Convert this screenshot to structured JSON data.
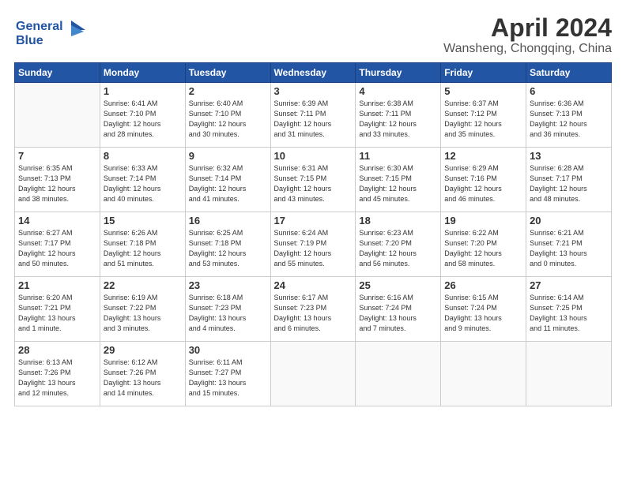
{
  "logo": {
    "line1": "General",
    "line2": "Blue"
  },
  "title": "April 2024",
  "location": "Wansheng, Chongqing, China",
  "headers": [
    "Sunday",
    "Monday",
    "Tuesday",
    "Wednesday",
    "Thursday",
    "Friday",
    "Saturday"
  ],
  "weeks": [
    [
      {
        "day": "",
        "info": ""
      },
      {
        "day": "1",
        "info": "Sunrise: 6:41 AM\nSunset: 7:10 PM\nDaylight: 12 hours\nand 28 minutes."
      },
      {
        "day": "2",
        "info": "Sunrise: 6:40 AM\nSunset: 7:10 PM\nDaylight: 12 hours\nand 30 minutes."
      },
      {
        "day": "3",
        "info": "Sunrise: 6:39 AM\nSunset: 7:11 PM\nDaylight: 12 hours\nand 31 minutes."
      },
      {
        "day": "4",
        "info": "Sunrise: 6:38 AM\nSunset: 7:11 PM\nDaylight: 12 hours\nand 33 minutes."
      },
      {
        "day": "5",
        "info": "Sunrise: 6:37 AM\nSunset: 7:12 PM\nDaylight: 12 hours\nand 35 minutes."
      },
      {
        "day": "6",
        "info": "Sunrise: 6:36 AM\nSunset: 7:13 PM\nDaylight: 12 hours\nand 36 minutes."
      }
    ],
    [
      {
        "day": "7",
        "info": "Sunrise: 6:35 AM\nSunset: 7:13 PM\nDaylight: 12 hours\nand 38 minutes."
      },
      {
        "day": "8",
        "info": "Sunrise: 6:33 AM\nSunset: 7:14 PM\nDaylight: 12 hours\nand 40 minutes."
      },
      {
        "day": "9",
        "info": "Sunrise: 6:32 AM\nSunset: 7:14 PM\nDaylight: 12 hours\nand 41 minutes."
      },
      {
        "day": "10",
        "info": "Sunrise: 6:31 AM\nSunset: 7:15 PM\nDaylight: 12 hours\nand 43 minutes."
      },
      {
        "day": "11",
        "info": "Sunrise: 6:30 AM\nSunset: 7:15 PM\nDaylight: 12 hours\nand 45 minutes."
      },
      {
        "day": "12",
        "info": "Sunrise: 6:29 AM\nSunset: 7:16 PM\nDaylight: 12 hours\nand 46 minutes."
      },
      {
        "day": "13",
        "info": "Sunrise: 6:28 AM\nSunset: 7:17 PM\nDaylight: 12 hours\nand 48 minutes."
      }
    ],
    [
      {
        "day": "14",
        "info": "Sunrise: 6:27 AM\nSunset: 7:17 PM\nDaylight: 12 hours\nand 50 minutes."
      },
      {
        "day": "15",
        "info": "Sunrise: 6:26 AM\nSunset: 7:18 PM\nDaylight: 12 hours\nand 51 minutes."
      },
      {
        "day": "16",
        "info": "Sunrise: 6:25 AM\nSunset: 7:18 PM\nDaylight: 12 hours\nand 53 minutes."
      },
      {
        "day": "17",
        "info": "Sunrise: 6:24 AM\nSunset: 7:19 PM\nDaylight: 12 hours\nand 55 minutes."
      },
      {
        "day": "18",
        "info": "Sunrise: 6:23 AM\nSunset: 7:20 PM\nDaylight: 12 hours\nand 56 minutes."
      },
      {
        "day": "19",
        "info": "Sunrise: 6:22 AM\nSunset: 7:20 PM\nDaylight: 12 hours\nand 58 minutes."
      },
      {
        "day": "20",
        "info": "Sunrise: 6:21 AM\nSunset: 7:21 PM\nDaylight: 13 hours\nand 0 minutes."
      }
    ],
    [
      {
        "day": "21",
        "info": "Sunrise: 6:20 AM\nSunset: 7:21 PM\nDaylight: 13 hours\nand 1 minute."
      },
      {
        "day": "22",
        "info": "Sunrise: 6:19 AM\nSunset: 7:22 PM\nDaylight: 13 hours\nand 3 minutes."
      },
      {
        "day": "23",
        "info": "Sunrise: 6:18 AM\nSunset: 7:23 PM\nDaylight: 13 hours\nand 4 minutes."
      },
      {
        "day": "24",
        "info": "Sunrise: 6:17 AM\nSunset: 7:23 PM\nDaylight: 13 hours\nand 6 minutes."
      },
      {
        "day": "25",
        "info": "Sunrise: 6:16 AM\nSunset: 7:24 PM\nDaylight: 13 hours\nand 7 minutes."
      },
      {
        "day": "26",
        "info": "Sunrise: 6:15 AM\nSunset: 7:24 PM\nDaylight: 13 hours\nand 9 minutes."
      },
      {
        "day": "27",
        "info": "Sunrise: 6:14 AM\nSunset: 7:25 PM\nDaylight: 13 hours\nand 11 minutes."
      }
    ],
    [
      {
        "day": "28",
        "info": "Sunrise: 6:13 AM\nSunset: 7:26 PM\nDaylight: 13 hours\nand 12 minutes."
      },
      {
        "day": "29",
        "info": "Sunrise: 6:12 AM\nSunset: 7:26 PM\nDaylight: 13 hours\nand 14 minutes."
      },
      {
        "day": "30",
        "info": "Sunrise: 6:11 AM\nSunset: 7:27 PM\nDaylight: 13 hours\nand 15 minutes."
      },
      {
        "day": "",
        "info": ""
      },
      {
        "day": "",
        "info": ""
      },
      {
        "day": "",
        "info": ""
      },
      {
        "day": "",
        "info": ""
      }
    ]
  ]
}
